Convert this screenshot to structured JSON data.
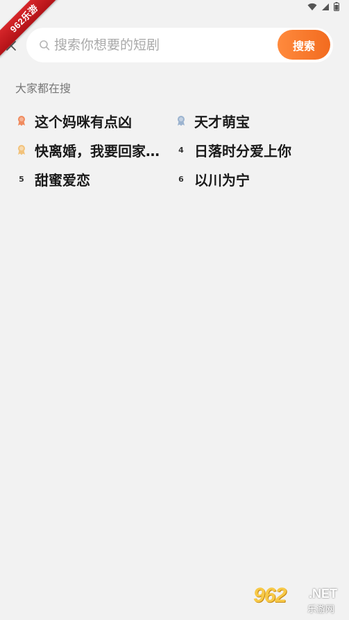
{
  "watermark": {
    "ribbon_text": "962乐游",
    "corner_main": "962",
    "corner_net": ".NET",
    "corner_sub": "乐游网"
  },
  "status_bar": {
    "icons": [
      "wifi-icon",
      "signal-icon",
      "battery-icon"
    ]
  },
  "search": {
    "placeholder": "搜索你想要的短剧",
    "value": "",
    "button_label": "搜索"
  },
  "hot_section": {
    "title": "大家都在搜",
    "items": [
      {
        "rank": "1",
        "text": "这个妈咪有点凶",
        "badge": "medal-gold"
      },
      {
        "rank": "2",
        "text": "天才萌宝",
        "badge": "medal-silver"
      },
      {
        "rank": "3",
        "text": "快离婚，我要回家…",
        "badge": "medal-bronze"
      },
      {
        "rank": "4",
        "text": "日落时分爱上你",
        "badge": "number"
      },
      {
        "rank": "5",
        "text": "甜蜜爱恋",
        "badge": "number"
      },
      {
        "rank": "6",
        "text": "以川为宁",
        "badge": "number"
      }
    ]
  },
  "colors": {
    "background": "#f2f2f2",
    "accent": "#f26b1f",
    "accent_light": "#ff8a3d",
    "medal_gold": "#f08a5d",
    "medal_silver": "#9bb3cf",
    "medal_bronze": "#f2c27a"
  }
}
